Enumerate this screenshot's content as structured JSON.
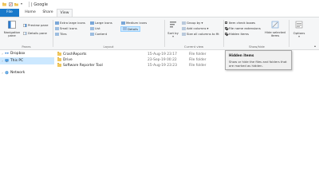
{
  "window": {
    "title": "Google"
  },
  "tabs": [
    "File",
    "Home",
    "Share",
    "View"
  ],
  "ribbon": {
    "panes": {
      "navigation_pane": "Navigation pane",
      "preview_pane": "Preview pane",
      "details_pane": "Details pane",
      "group_label": "Panes"
    },
    "layout": {
      "items": [
        "Extra large icons",
        "Large icons",
        "Medium icons",
        "Small icons",
        "List",
        "Details",
        "Tiles",
        "Content"
      ],
      "group_label": "Layout"
    },
    "current_view": {
      "sort_by": "Sort by",
      "group_by": "Group by",
      "add_columns": "Add columns",
      "size_columns": "Size all columns to fit",
      "group_label": "Current view"
    },
    "show_hide": {
      "item_check_boxes": {
        "label": "Item check boxes",
        "checked": false
      },
      "file_name_extensions": {
        "label": "File name extensions",
        "checked": true
      },
      "hidden_items": {
        "label": "Hidden items",
        "checked": true
      },
      "hide_selected": "Hide selected items",
      "group_label": "Show/hide"
    },
    "options": "Options"
  },
  "tooltip": {
    "title": "Hidden items",
    "body": "Show or hide the files and folders that are marked as hidden."
  },
  "nav": {
    "items": [
      {
        "label": "Dropbox",
        "icon": "dropbox-icon",
        "selected": false
      },
      {
        "label": "This PC",
        "icon": "computer-icon",
        "selected": true
      },
      {
        "label": "Network",
        "icon": "network-icon",
        "selected": false
      }
    ]
  },
  "files": [
    {
      "name": "CrashReports",
      "date": "15-Aug-19 23:17",
      "type": "File folder"
    },
    {
      "name": "Drive",
      "date": "23-Sep-19 00:22",
      "type": "File folder"
    },
    {
      "name": "Software Reporter Tool",
      "date": "15-Aug-19 23:23",
      "type": "File folder"
    }
  ],
  "colors": {
    "accent": "#1979ca",
    "selection": "#cce8ff",
    "folder": "#f0c75e"
  }
}
